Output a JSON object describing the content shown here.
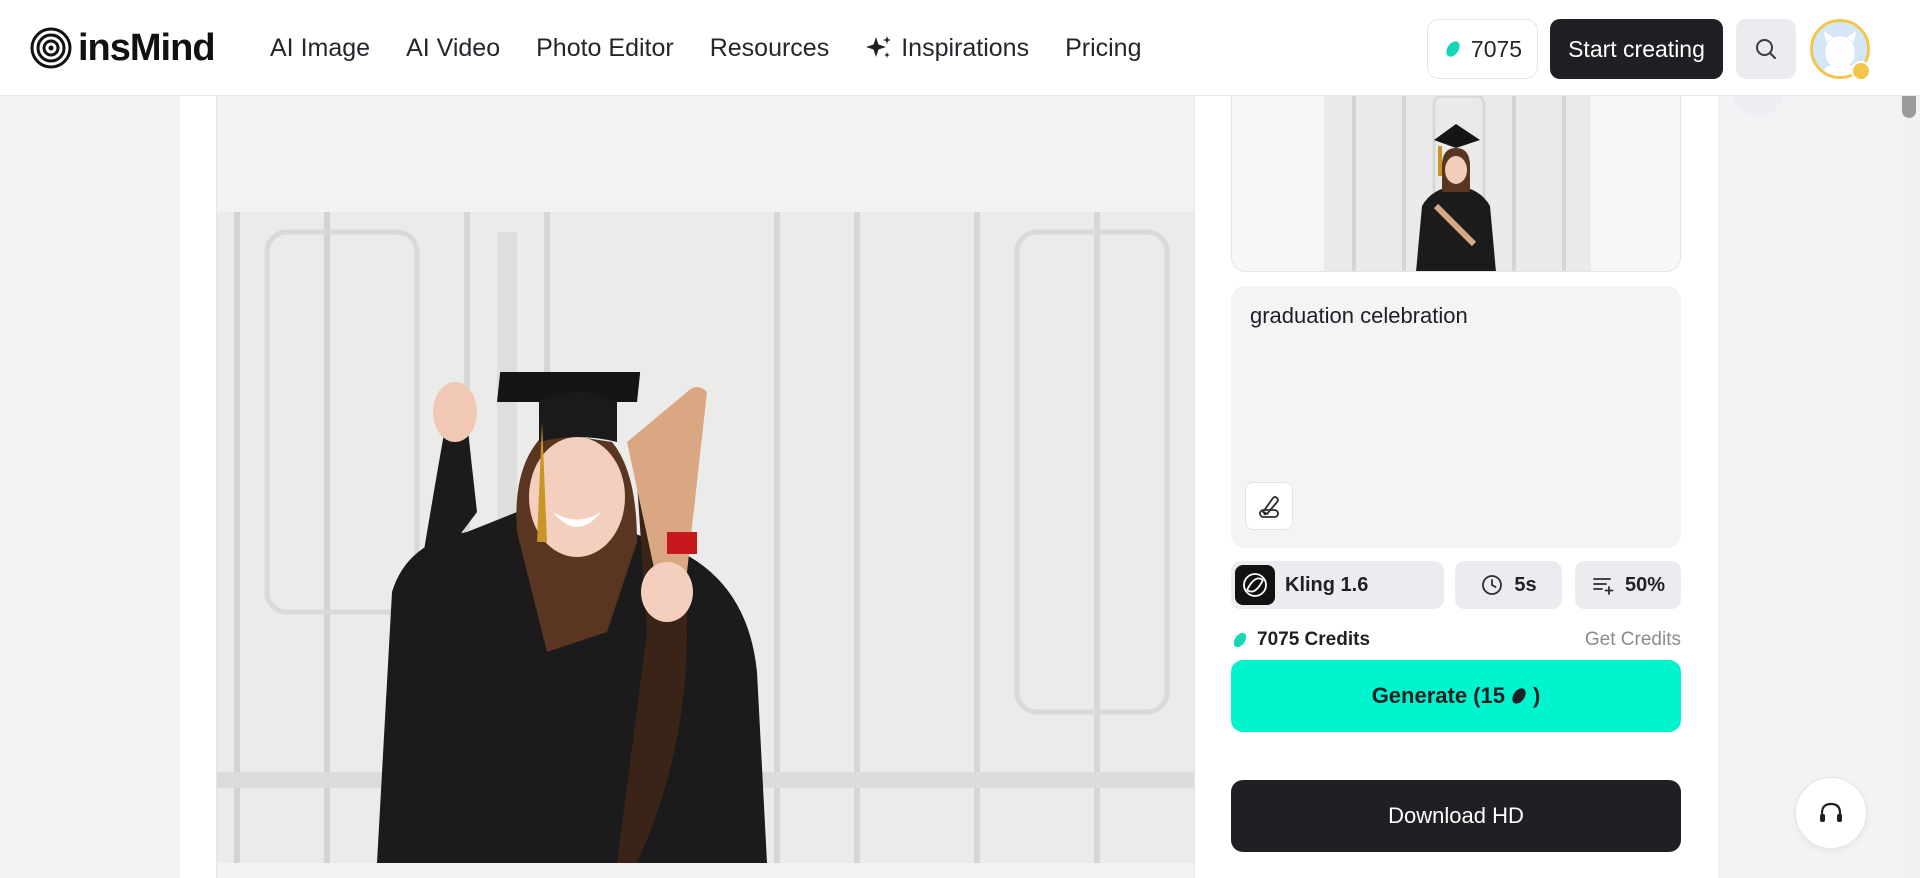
{
  "brand": {
    "name": "insMind"
  },
  "nav": {
    "items": [
      {
        "label": "AI Image",
        "icon": ""
      },
      {
        "label": "AI Video",
        "icon": ""
      },
      {
        "label": "Photo Editor",
        "icon": ""
      },
      {
        "label": "Resources",
        "icon": ""
      },
      {
        "label": "Inspirations",
        "icon": "sparkle-icon"
      },
      {
        "label": "Pricing",
        "icon": ""
      }
    ]
  },
  "header": {
    "credits": "7075",
    "start_label": "Start creating",
    "search_icon": "search-icon",
    "avatar_icon": "avatar"
  },
  "panel": {
    "prompt": "graduation celebration",
    "model_label": "Kling 1.6",
    "duration_label": "5s",
    "strength_label": "50%",
    "credits_label": "7075 Credits",
    "get_credits_label": "Get Credits",
    "generate_label": "Generate (15",
    "generate_suffix": ")",
    "download_label": "Download HD"
  },
  "colors": {
    "accent": "#00f5cf",
    "dark": "#1f2023",
    "avatar_ring": "#f3c64a"
  }
}
